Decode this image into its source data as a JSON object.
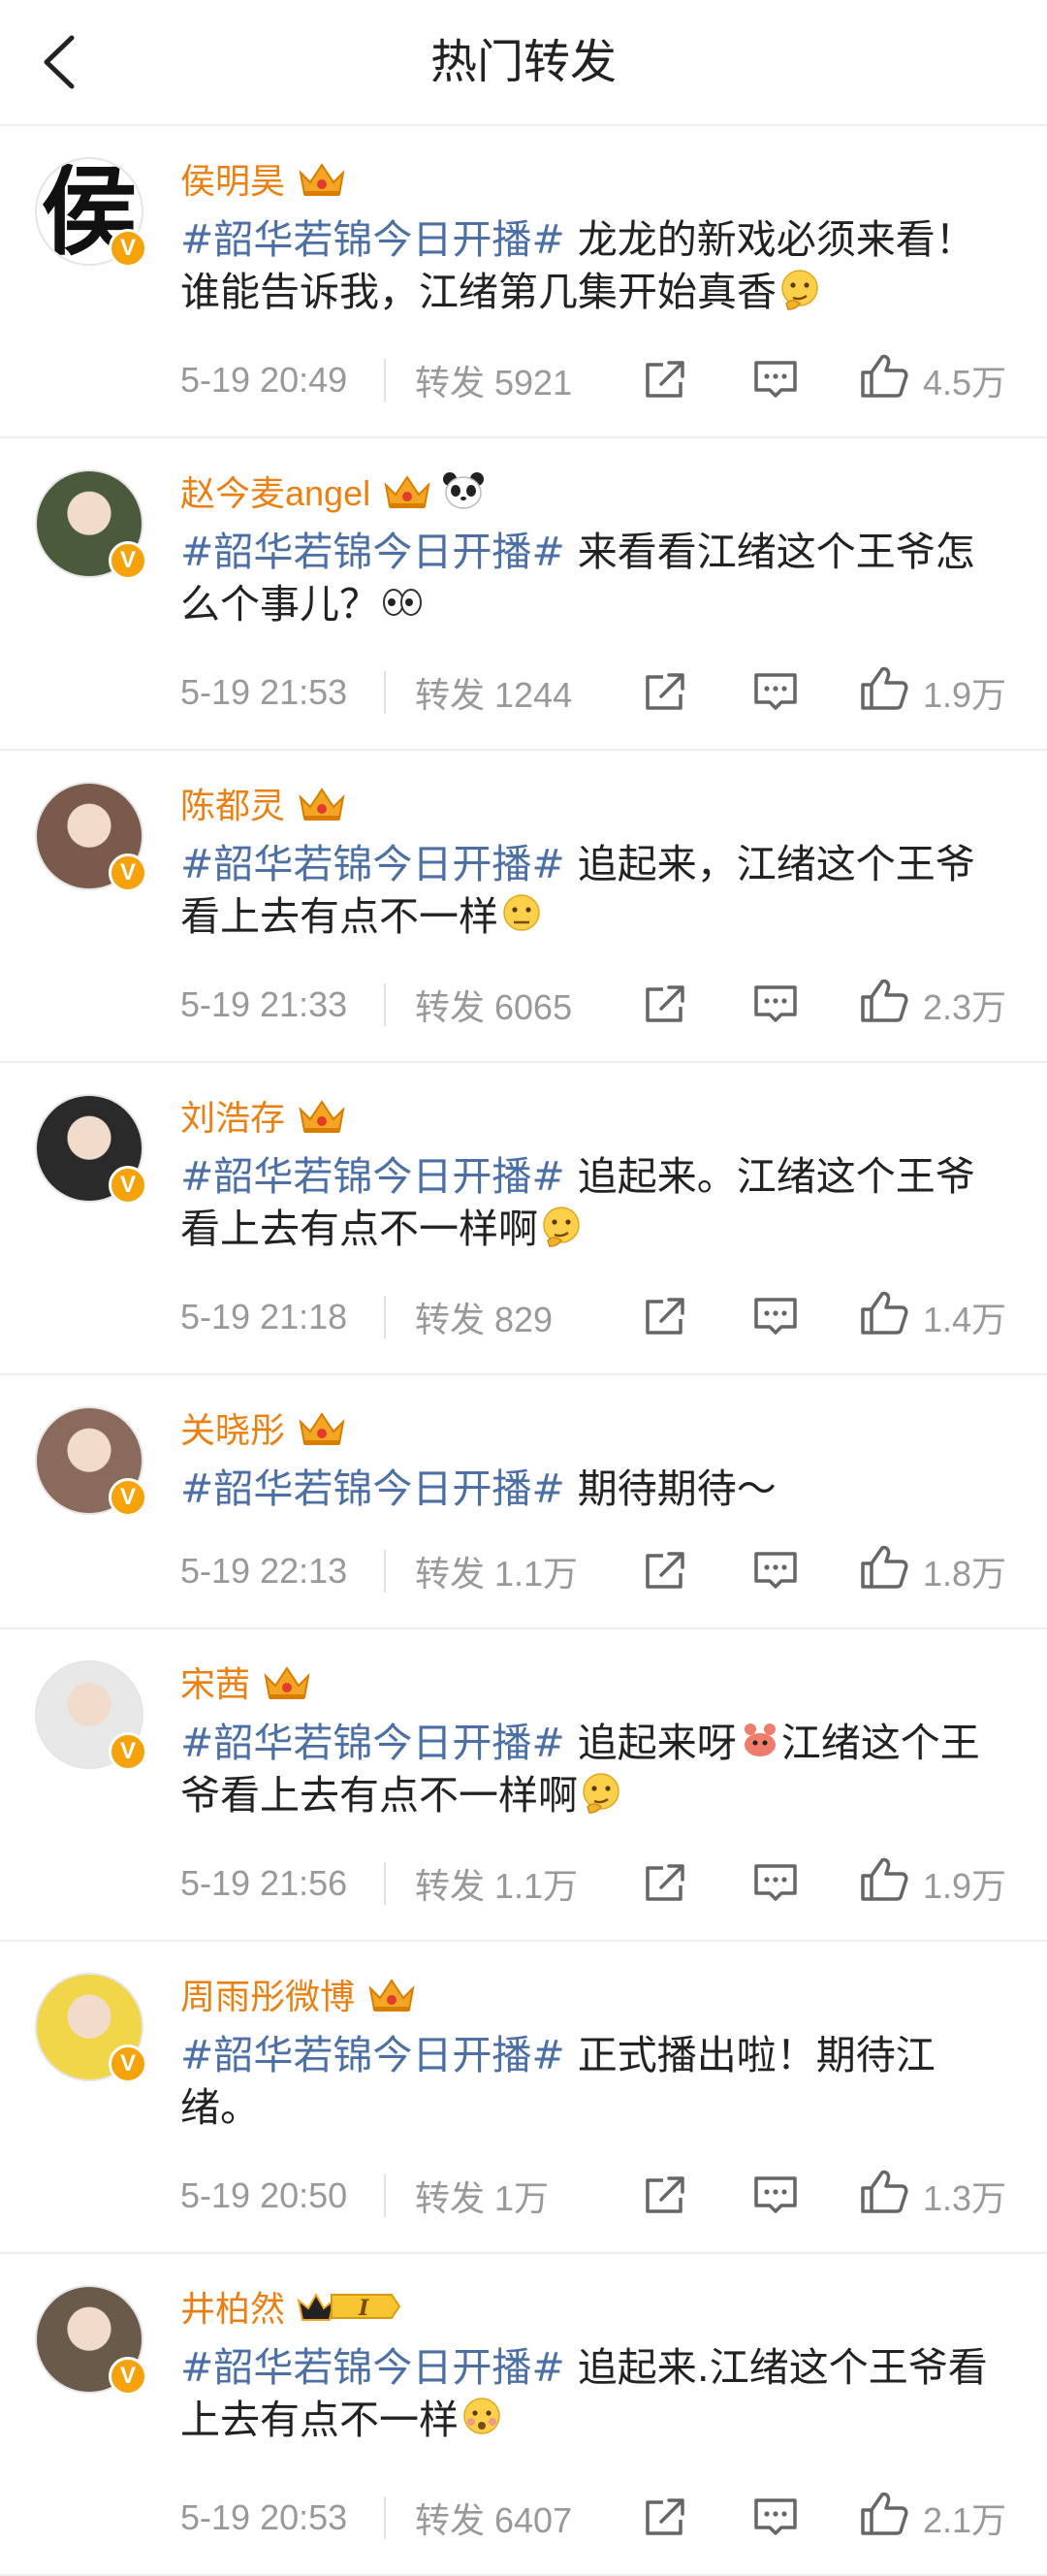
{
  "header": {
    "title": "热门转发",
    "back_icon": "chevron-left-icon"
  },
  "colors": {
    "username": "#ea8011",
    "topic": "#4c6fa5",
    "meta": "#999999",
    "verified": "#f6a20a"
  },
  "posts": [
    {
      "name": "侯明昊",
      "avatar_char": "侯",
      "crown": true,
      "extra_badge": "",
      "topic": "#韶华若锦今日开播#",
      "text": " 龙龙的新戏必须来看！谁能告诉我，江绪第几集开始真香",
      "emoji": "thinking",
      "time": "5-19 20:49",
      "reposts": "转发 5921",
      "likes": "4.5万"
    },
    {
      "name": "赵今麦angel",
      "avatar_char": "",
      "crown": true,
      "extra_badge": "panda",
      "topic": "#韶华若锦今日开播#",
      "text": " 来看看江绪这个王爷怎么个事儿？",
      "emoji": "eyes",
      "time": "5-19 21:53",
      "reposts": "转发 1244",
      "likes": "1.9万"
    },
    {
      "name": "陈都灵",
      "avatar_char": "",
      "crown": true,
      "extra_badge": "",
      "topic": "#韶华若锦今日开播#",
      "text": " 追起来，江绪这个王爷看上去有点不一样",
      "emoji": "smirk",
      "time": "5-19 21:33",
      "reposts": "转发 6065",
      "likes": "2.3万"
    },
    {
      "name": "刘浩存",
      "avatar_char": "",
      "crown": true,
      "extra_badge": "",
      "topic": "#韶华若锦今日开播#",
      "text": " 追起来。江绪这个王爷看上去有点不一样啊",
      "emoji": "thinking",
      "time": "5-19 21:18",
      "reposts": "转发 829",
      "likes": "1.4万"
    },
    {
      "name": "关晓彤",
      "avatar_char": "",
      "crown": true,
      "extra_badge": "",
      "topic": "#韶华若锦今日开播#",
      "text": " 期待期待～",
      "emoji": "",
      "time": "5-19 22:13",
      "reposts": "转发 1.1万",
      "likes": "1.8万"
    },
    {
      "name": "宋茜",
      "avatar_char": "",
      "crown": true,
      "extra_badge": "",
      "topic": "#韶华若锦今日开播#",
      "text": " 追起来呀",
      "text2": "江绪这个王爷看上去有点不一样啊",
      "emoji_mid": "crab",
      "emoji": "thinking",
      "time": "5-19 21:56",
      "reposts": "转发 1.1万",
      "likes": "1.9万"
    },
    {
      "name": "周雨彤微博",
      "avatar_char": "",
      "crown": true,
      "extra_badge": "",
      "topic": "#韶华若锦今日开播#",
      "text": " 正式播出啦！期待江绪。",
      "emoji": "",
      "time": "5-19 20:50",
      "reposts": "转发 1万",
      "likes": "1.3万"
    },
    {
      "name": "井柏然",
      "avatar_char": "",
      "crown": false,
      "extra_badge": "level-1",
      "topic": "#韶华若锦今日开播#",
      "text": " 追起来.江绪这个王爷看上去有点不一样",
      "emoji": "shy",
      "time": "5-19 20:53",
      "reposts": "转发 6407",
      "likes": "2.1万"
    }
  ],
  "icons": {
    "share": "share-icon",
    "comment": "comment-icon",
    "like": "thumbs-up-icon",
    "verified": "verified-v-icon",
    "crown": "crown-icon"
  },
  "verified_mark": "V",
  "level_badge_text": "I"
}
